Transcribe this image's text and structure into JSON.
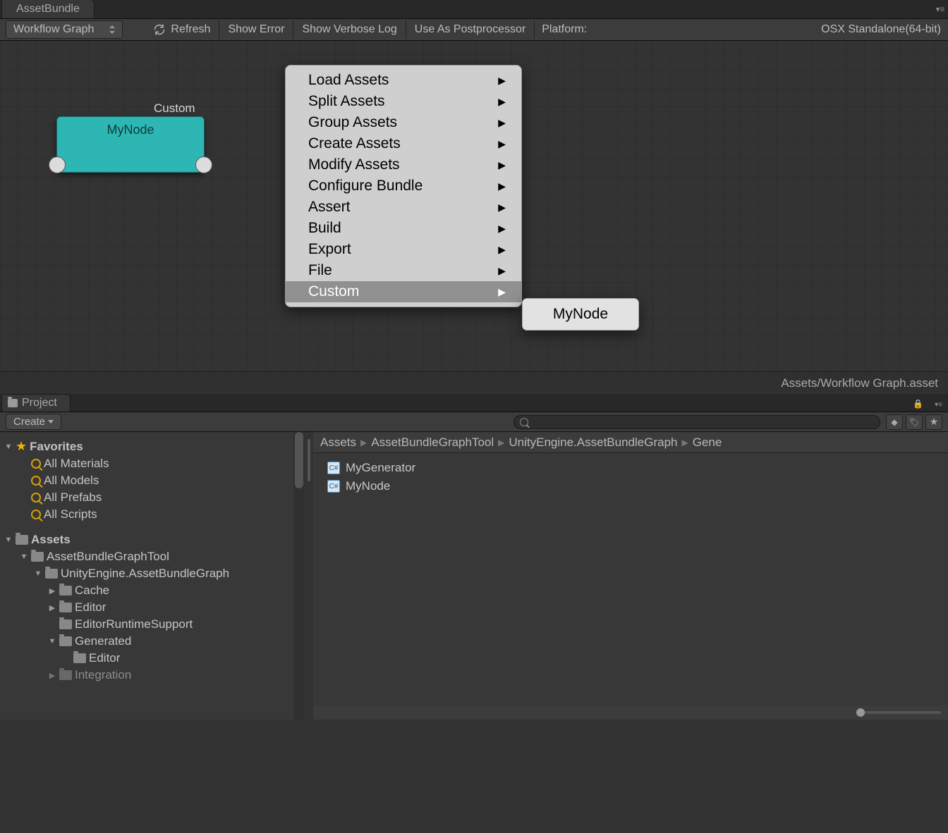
{
  "tabs": {
    "main": "AssetBundle"
  },
  "toolbar": {
    "dropdown": "Workflow Graph",
    "refresh": "Refresh",
    "show_error": "Show Error",
    "show_verbose": "Show Verbose Log",
    "use_as_post": "Use As Postprocessor",
    "platform_label": "Platform:",
    "platform_value": "OSX Standalone(64-bit)"
  },
  "node": {
    "title": "MyNode",
    "subtitle": "Custom"
  },
  "context_menu": {
    "items": [
      "Load Assets",
      "Split Assets",
      "Group Assets",
      "Create Assets",
      "Modify Assets",
      "Configure Bundle",
      "Assert",
      "Build",
      "Export",
      "File",
      "Custom"
    ],
    "highlighted_index": 10,
    "submenu": [
      "MyNode"
    ]
  },
  "graph_footer": "Assets/Workflow Graph.asset",
  "project": {
    "tab": "Project",
    "create": "Create",
    "tree": {
      "favorites": "Favorites",
      "fav_items": [
        "All Materials",
        "All Models",
        "All Prefabs",
        "All Scripts"
      ],
      "assets": "Assets",
      "a1": "AssetBundleGraphTool",
      "a2": "UnityEngine.AssetBundleGraph",
      "a3": [
        "Cache",
        "Editor",
        "EditorRuntimeSupport",
        "Generated",
        "Integration"
      ],
      "a4": "Editor"
    },
    "breadcrumb": [
      "Assets",
      "AssetBundleGraphTool",
      "UnityEngine.AssetBundleGraph",
      "Gene"
    ],
    "files": [
      "MyGenerator",
      "MyNode"
    ]
  }
}
